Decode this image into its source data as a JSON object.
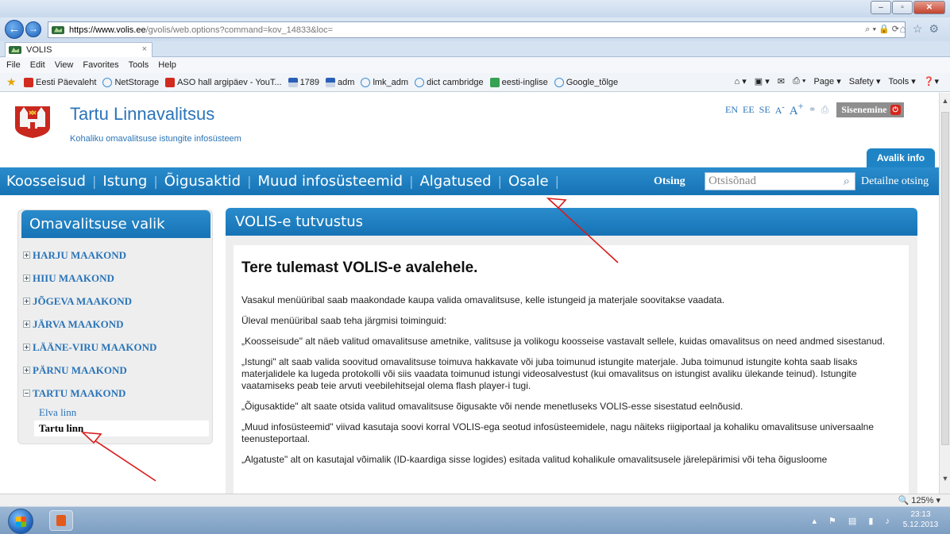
{
  "browser": {
    "url_host": "https://www.volis.ee",
    "url_path": "/gvolis/web.options?command=kov_14833&loc=",
    "tab_title": "VOLIS",
    "menu": [
      "File",
      "Edit",
      "View",
      "Favorites",
      "Tools",
      "Help"
    ],
    "favorites": [
      {
        "label": "Eesti Päevaleht",
        "icon": "red"
      },
      {
        "label": "NetStorage",
        "icon": "ie"
      },
      {
        "label": "ASO hall argipäev - YouT...",
        "icon": "red"
      },
      {
        "label": "1789",
        "icon": "flag"
      },
      {
        "label": "adm",
        "icon": "flag"
      },
      {
        "label": "lmk_adm",
        "icon": "ie"
      },
      {
        "label": "dict cambridge",
        "icon": "ie"
      },
      {
        "label": "eesti-inglise",
        "icon": "green"
      },
      {
        "label": "Google_tõlge",
        "icon": "ie"
      }
    ],
    "commands": [
      "Page ▾",
      "Safety ▾",
      "Tools ▾"
    ],
    "zoom": "125%"
  },
  "header": {
    "title": "Tartu Linnavalitsus",
    "subtitle": "Kohaliku omavalitsuse istungite infosüsteem",
    "languages": [
      "EN",
      "EE",
      "SE"
    ],
    "font_small": "A",
    "font_large": "A",
    "login": "Sisenemine",
    "public_tab": "Avalik info"
  },
  "nav": {
    "items": [
      "Koosseisud",
      "Istung",
      "Õigusaktid",
      "Muud infosüsteemid",
      "Algatused",
      "Osale"
    ],
    "search_label": "Otsing",
    "search_placeholder": "Otsisõnad",
    "detailed_search": "Detailne otsing"
  },
  "left": {
    "title": "Omavalitsuse valik",
    "counties": [
      {
        "name": "HARJU MAAKOND",
        "expanded": false
      },
      {
        "name": "HIIU MAAKOND",
        "expanded": false
      },
      {
        "name": "JÕGEVA MAAKOND",
        "expanded": false
      },
      {
        "name": "JÄRVA MAAKOND",
        "expanded": false
      },
      {
        "name": "LÄÄNE-VIRU MAAKOND",
        "expanded": false
      },
      {
        "name": "PÄRNU MAAKOND",
        "expanded": false
      },
      {
        "name": "TARTU MAAKOND",
        "expanded": true
      }
    ],
    "municipalities": [
      "Elva linn",
      "Tartu linn"
    ],
    "selected": "Tartu linn"
  },
  "content": {
    "panel_title": "VOLIS-e tutvustus",
    "heading": "Tere tulemast VOLIS-e avalehele.",
    "paragraphs": [
      "Vasakul menüüribal saab maakondade kaupa valida omavalitsuse, kelle istungeid ja materjale soovitakse vaadata.",
      "Üleval menüüribal saab teha järgmisi toiminguid:",
      "„Koosseisude\" alt näeb valitud omavalitsuse ametnike, valitsuse ja volikogu koosseise vastavalt sellele, kuidas omavalitsus on need andmed sisestanud.",
      "„Istungi\" alt saab valida soovitud omavalitsuse toimuva hakkavate või juba toimunud istungite materjale. Juba toimunud istungite kohta saab lisaks materjalidele ka lugeda protokolli või siis vaadata toimunud istungi videosalvestust (kui omavalitsus on istungist avaliku ülekande teinud). Istungite vaatamiseks peab teie arvuti veebilehitsejal olema flash player-i tugi.",
      "„Õigusaktide\" alt saate otsida valitud omavalitsuse õigusakte või nende menetluseks VOLIS-esse sisestatud eelnõusid.",
      "„Muud infosüsteemid\" viivad kasutaja soovi korral VOLIS-ega seotud infosüsteemidele, nagu näiteks riigiportaal ja kohaliku omavalitsuse universaalne teenusteportaal.",
      "„Algatuste\" alt on kasutajal võimalik (ID-kaardiga sisse logides) esitada valitud kohalikule omavalitsusele järelepärimisi või teha õigusloome"
    ]
  },
  "taskbar": {
    "time": "23:13",
    "date": "5.12.2013"
  }
}
